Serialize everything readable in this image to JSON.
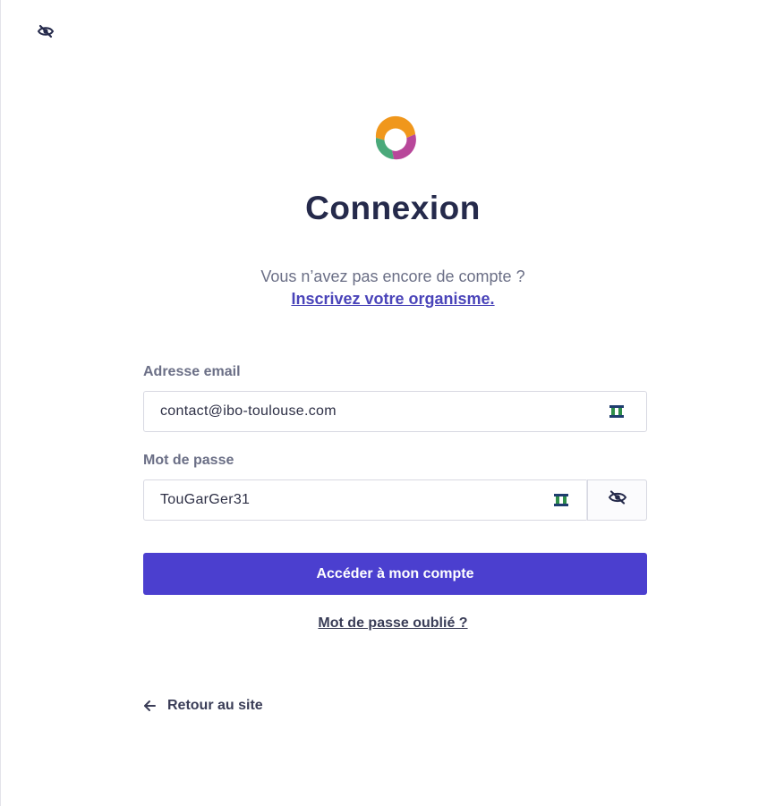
{
  "page": {
    "title": "Connexion",
    "signup_prompt": "Vous n’avez pas encore de compte ?",
    "signup_link": "Inscrivez votre organisme."
  },
  "form": {
    "email": {
      "label": "Adresse email",
      "value": "contact@ibo-toulouse.com"
    },
    "password": {
      "label": "Mot de passe",
      "value": "TouGarGer31"
    },
    "submit_label": "Accéder à mon compte",
    "forgot_label": "Mot de passe oublié ?"
  },
  "footer": {
    "back_label": "Retour au site"
  },
  "icons": {
    "corner": "eye-slash-icon",
    "logo": "play-circle-logo",
    "password_manager": "password-manager-icon",
    "reveal": "eye-slash-icon",
    "back": "arrow-left-icon"
  },
  "colors": {
    "primary": "#4b3fcf",
    "heading": "#252a4b",
    "muted": "#6b6f86",
    "link": "#4a44b9",
    "logo_orange": "#f0971c",
    "logo_magenta": "#b8479a",
    "logo_green": "#4aa97a"
  }
}
